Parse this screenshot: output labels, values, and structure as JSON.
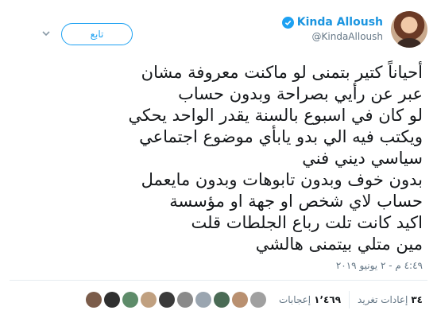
{
  "user": {
    "display_name": "Kinda Alloush",
    "handle": "@KindaAlloush",
    "verified": true
  },
  "follow_label": "تابع",
  "icons": {
    "verified": "verified-badge-icon",
    "menu": "chevron-down-icon"
  },
  "tweet": {
    "lines": [
      "أحياناً كتير بتمنى لو ماكنت معروفة مشان",
      "عبر عن رأيي بصراحة وبدون حساب",
      "لو كان في اسبوع بالسنة يقدر الواحد يحكي",
      "ويكتب فيه الي بدو يابأي موضوع اجتماعي",
      "سياسي ديني فني",
      "بدون خوف وبدون تابوهات وبدون مايعمل",
      "حساب لاي شخص او جهة او مؤسسة",
      "اكيد كانت تلت رباع الجلطات قلت",
      "مين متلي بيتمنى هالشي"
    ],
    "timestamp": "٤:٤٩ م - ٢ يونيو ٢٠١٩"
  },
  "stats": {
    "retweets_count": "٣٤",
    "retweets_label": "إعادات تغريد",
    "likes_count": "١٬٤٦٩",
    "likes_label": "إعجابات"
  },
  "colors": {
    "accent": "#1da1f2",
    "link": "#1b95e0",
    "text": "#14171a",
    "muted": "#657786",
    "border": "#e6ecf0"
  },
  "likers": [
    "#7b5c4a",
    "#2f2f2f",
    "#5e8c6a",
    "#c0a080",
    "#3a3a3a",
    "#8a8a8a",
    "#9aa5b0",
    "#4a6b55",
    "#b99070",
    "#a0a0a0"
  ]
}
